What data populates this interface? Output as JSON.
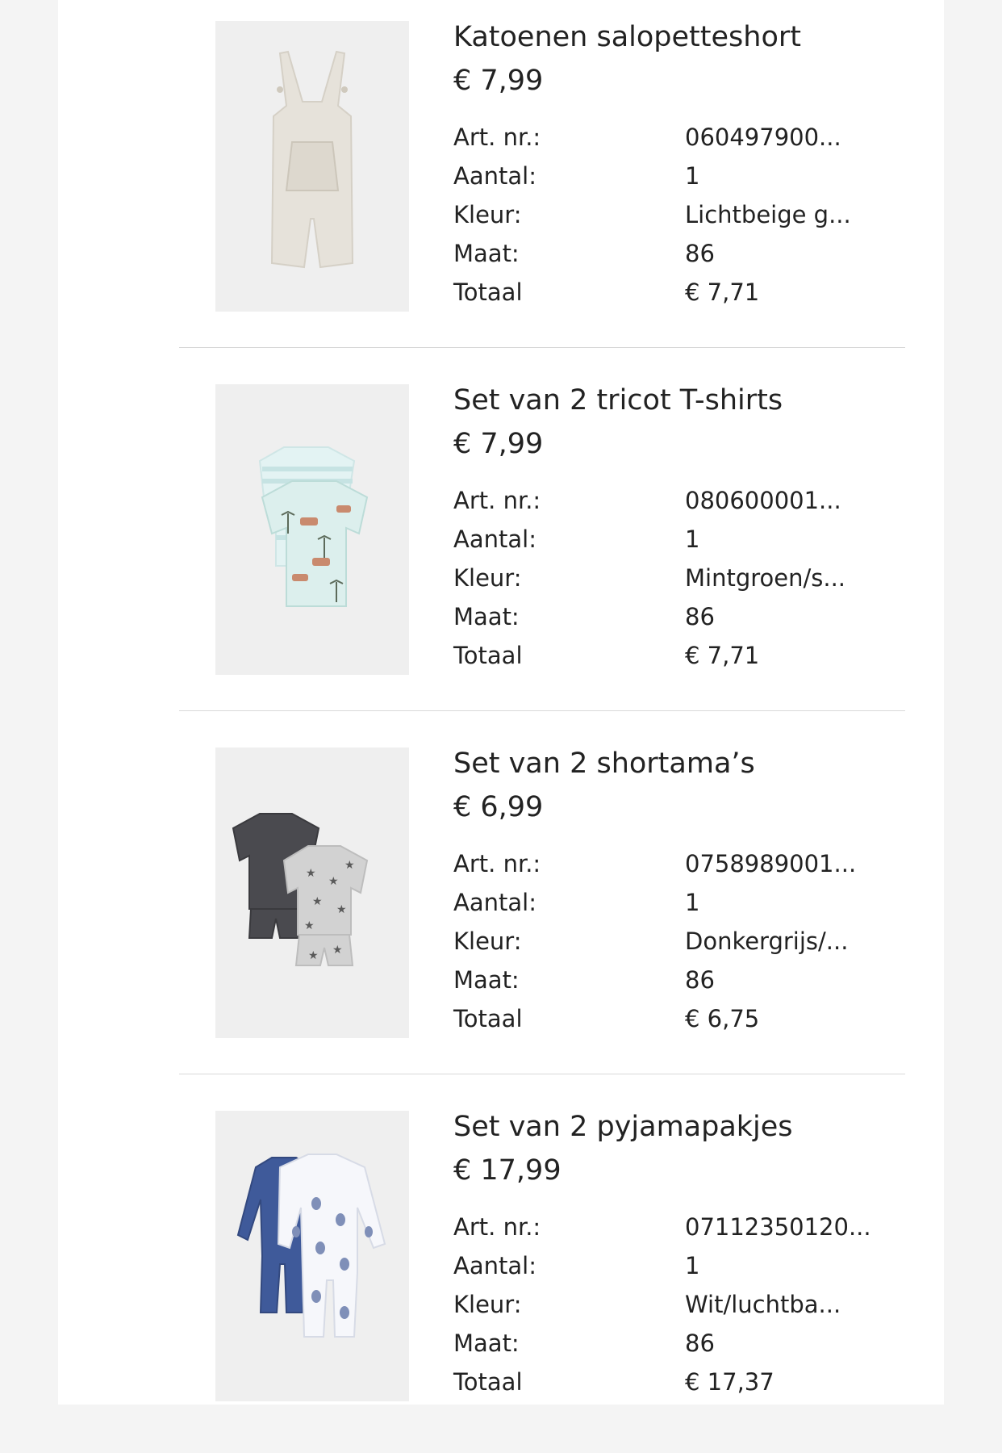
{
  "labels": {
    "art_nr": "Art. nr.:",
    "aantal": "Aantal:",
    "kleur": "Kleur:",
    "maat": "Maat:",
    "totaal": "Totaal"
  },
  "items": [
    {
      "title": "Katoenen salopetteshort",
      "price": "€ 7,99",
      "art_nr": "060497900...",
      "aantal": "1",
      "kleur": "Lichtbeige g...",
      "maat": "86",
      "totaal": "€ 7,71",
      "image_icon": "overall-shorts-image"
    },
    {
      "title": "Set van 2 tricot T-shirts",
      "price": "€ 7,99",
      "art_nr": "080600001...",
      "aantal": "1",
      "kleur": "Mintgroen/s...",
      "maat": "86",
      "totaal": "€ 7,71",
      "image_icon": "tshirts-image"
    },
    {
      "title": "Set van 2 shortama’s",
      "price": "€ 6,99",
      "art_nr": "0758989001...",
      "aantal": "1",
      "kleur": "Donkergrijs/...",
      "maat": "86",
      "totaal": "€ 6,75",
      "image_icon": "shortama-image"
    },
    {
      "title": "Set van 2 pyjamapakjes",
      "price": "€ 17,99",
      "art_nr": "07112350120...",
      "aantal": "1",
      "kleur": "Wit/luchtba...",
      "maat": "86",
      "totaal": "€ 17,37",
      "image_icon": "pyjama-image"
    }
  ],
  "colors": {
    "page_bg": "#f4f4f4",
    "panel_bg": "#ffffff",
    "image_bg": "#efefef",
    "text": "#222222",
    "divider": "#d8d8d8"
  }
}
